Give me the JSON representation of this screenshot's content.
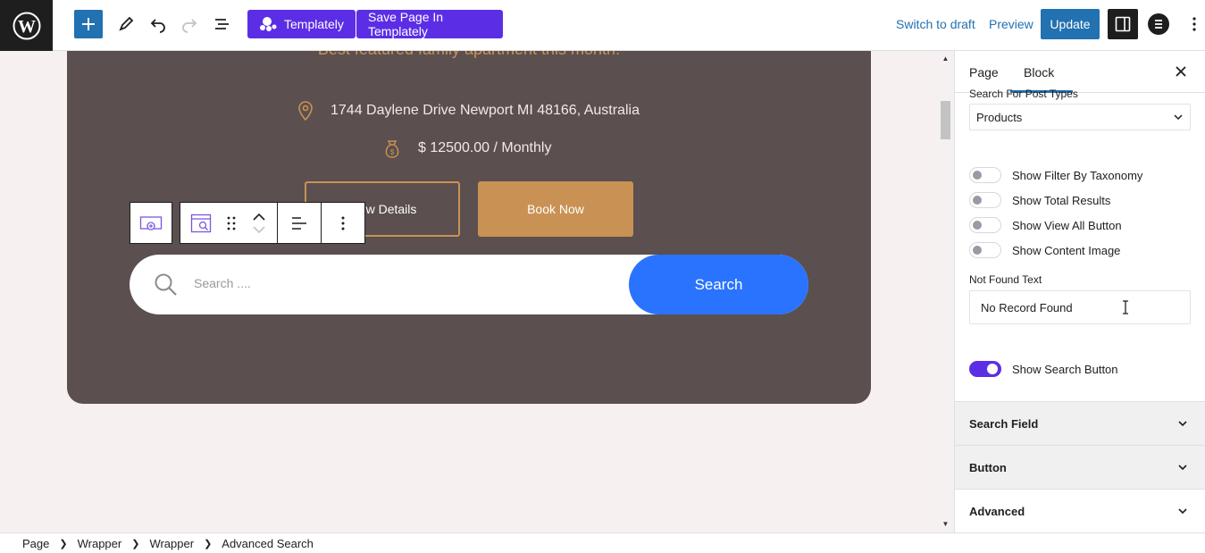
{
  "toolbar": {
    "templately_label": "Templately",
    "save_templately_label": "Save Page In Templately",
    "switch_draft_label": "Switch to draft",
    "preview_label": "Preview",
    "update_label": "Update"
  },
  "card": {
    "subtitle": "Best featured family apartment this month.",
    "address": "1744 Daylene Drive Newport MI 48166, Australia",
    "price": "$ 12500.00 / Monthly",
    "view_details_label": "View Details",
    "book_now_label": "Book Now",
    "search_placeholder": "Search ....",
    "search_button_label": "Search"
  },
  "sidebar": {
    "tabs": [
      "Page",
      "Block"
    ],
    "active_tab": "Block",
    "post_types_label": "Search For Post Types",
    "post_types_value": "Products",
    "toggles": [
      {
        "label": "Show Filter By Taxonomy",
        "on": false
      },
      {
        "label": "Show Total Results",
        "on": false
      },
      {
        "label": "Show View All Button",
        "on": false
      },
      {
        "label": "Show Content Image",
        "on": false
      }
    ],
    "not_found_label": "Not Found Text",
    "not_found_value": "No Record Found",
    "search_button_toggle": {
      "label": "Show Search Button",
      "on": true
    },
    "panels": [
      "Search Field",
      "Button",
      "Advanced"
    ]
  },
  "breadcrumb": [
    "Page",
    "Wrapper",
    "Wrapper",
    "Advanced Search"
  ],
  "colors": {
    "accent": "#2271b1",
    "templately": "#5b2ee6",
    "card_bg": "#5b4f4f",
    "gold": "#c99254",
    "search_blue": "#2a73ff"
  }
}
